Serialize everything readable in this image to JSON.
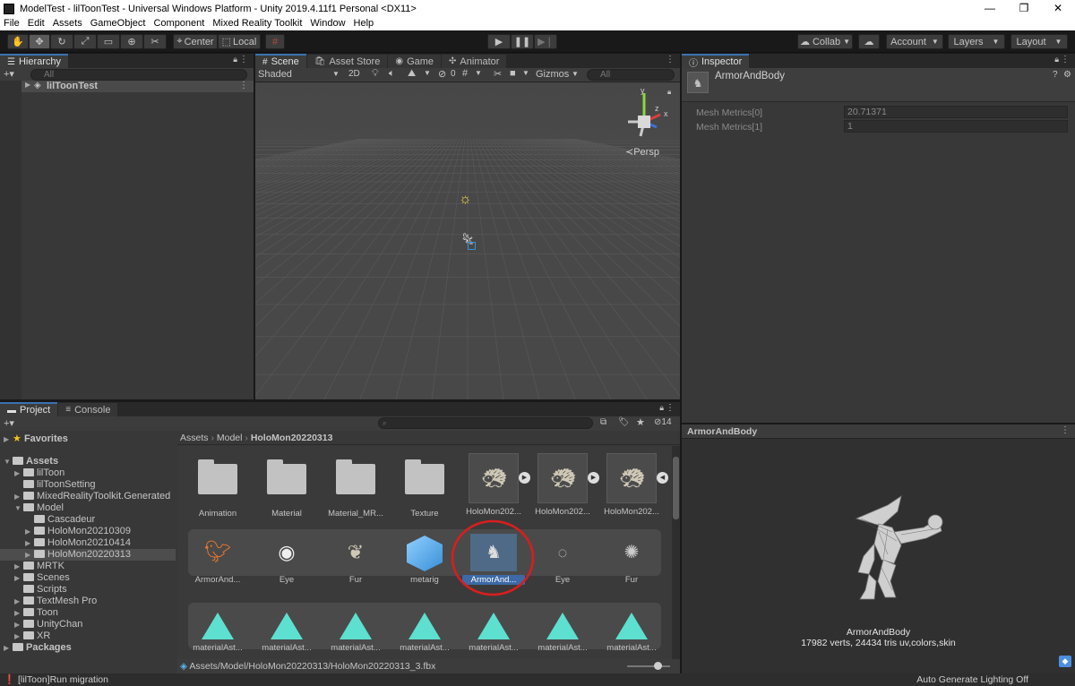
{
  "window": {
    "title": "ModelTest - lilToonTest - Universal Windows Platform - Unity 2019.4.11f1 Personal <DX11>",
    "minimize": "—",
    "restore": "❐",
    "close": "✕"
  },
  "menu": [
    "File",
    "Edit",
    "Assets",
    "GameObject",
    "Component",
    "Mixed Reality Toolkit",
    "Window",
    "Help"
  ],
  "toolbar": {
    "pivot": "Center",
    "space": "Local",
    "collab": "Collab",
    "account": "Account",
    "layers": "Layers",
    "layout": "Layout"
  },
  "hierarchy": {
    "tab": "Hierarchy",
    "add": "+▾",
    "search_placeholder": "All",
    "root": "lilToonTest"
  },
  "scene": {
    "tabs": [
      "Scene",
      "Asset Store",
      "Game",
      "Animator"
    ],
    "shading": "Shaded",
    "mode2d": "2D",
    "fx_count": "0",
    "gizmos": "Gizmos",
    "search_placeholder": "All",
    "persp": "Persp",
    "gizmo_axes": {
      "y": "y",
      "x": "x",
      "z": "z"
    }
  },
  "inspector": {
    "tab": "Inspector",
    "object_name": "ArmorAndBody",
    "fields": [
      {
        "label": "Mesh Metrics[0]",
        "value": "20.71371"
      },
      {
        "label": "Mesh Metrics[1]",
        "value": "1"
      }
    ]
  },
  "preview": {
    "header": "ArmorAndBody",
    "name": "ArmorAndBody",
    "stats": "17982 verts, 24434 tris   uv,colors,skin"
  },
  "project": {
    "tabs": [
      "Project",
      "Console"
    ],
    "add": "+▾",
    "hidden_count": "14",
    "breadcrumb": [
      "Assets",
      "Model",
      "HoloMon20220313"
    ],
    "tree": {
      "favorites": "Favorites",
      "assets": "Assets",
      "items": [
        "lilToon",
        "lilToonSetting",
        "MixedRealityToolkit.Generated",
        "Model",
        "Cascadeur",
        "HoloMon20210309",
        "HoloMon20210414",
        "HoloMon20220313",
        "MRTK",
        "Scenes",
        "Scripts",
        "TextMesh Pro",
        "Toon",
        "UnityChan",
        "XR"
      ],
      "packages": "Packages"
    },
    "row1": [
      "Animation",
      "Material",
      "Material_MR...",
      "Texture",
      "HoloMon202...",
      "HoloMon202...",
      "HoloMon202..."
    ],
    "row2": [
      "ArmorAnd...",
      "Eye",
      "Fur",
      "metarig",
      "ArmorAnd...",
      "Eye",
      "Fur"
    ],
    "row3": [
      "materialAst...",
      "materialAst...",
      "materialAst...",
      "materialAst...",
      "materialAst...",
      "materialAst...",
      "materialAst..."
    ],
    "path": "Assets/Model/HoloMon20220313/HoloMon20220313_3.fbx"
  },
  "status": {
    "left": "[lilToon]Run migration",
    "right": "Auto Generate Lighting Off"
  },
  "colors": {
    "accent": "#3a72b0",
    "highlight_circle": "#d81e1e",
    "material_icon": "#5de0cf"
  }
}
